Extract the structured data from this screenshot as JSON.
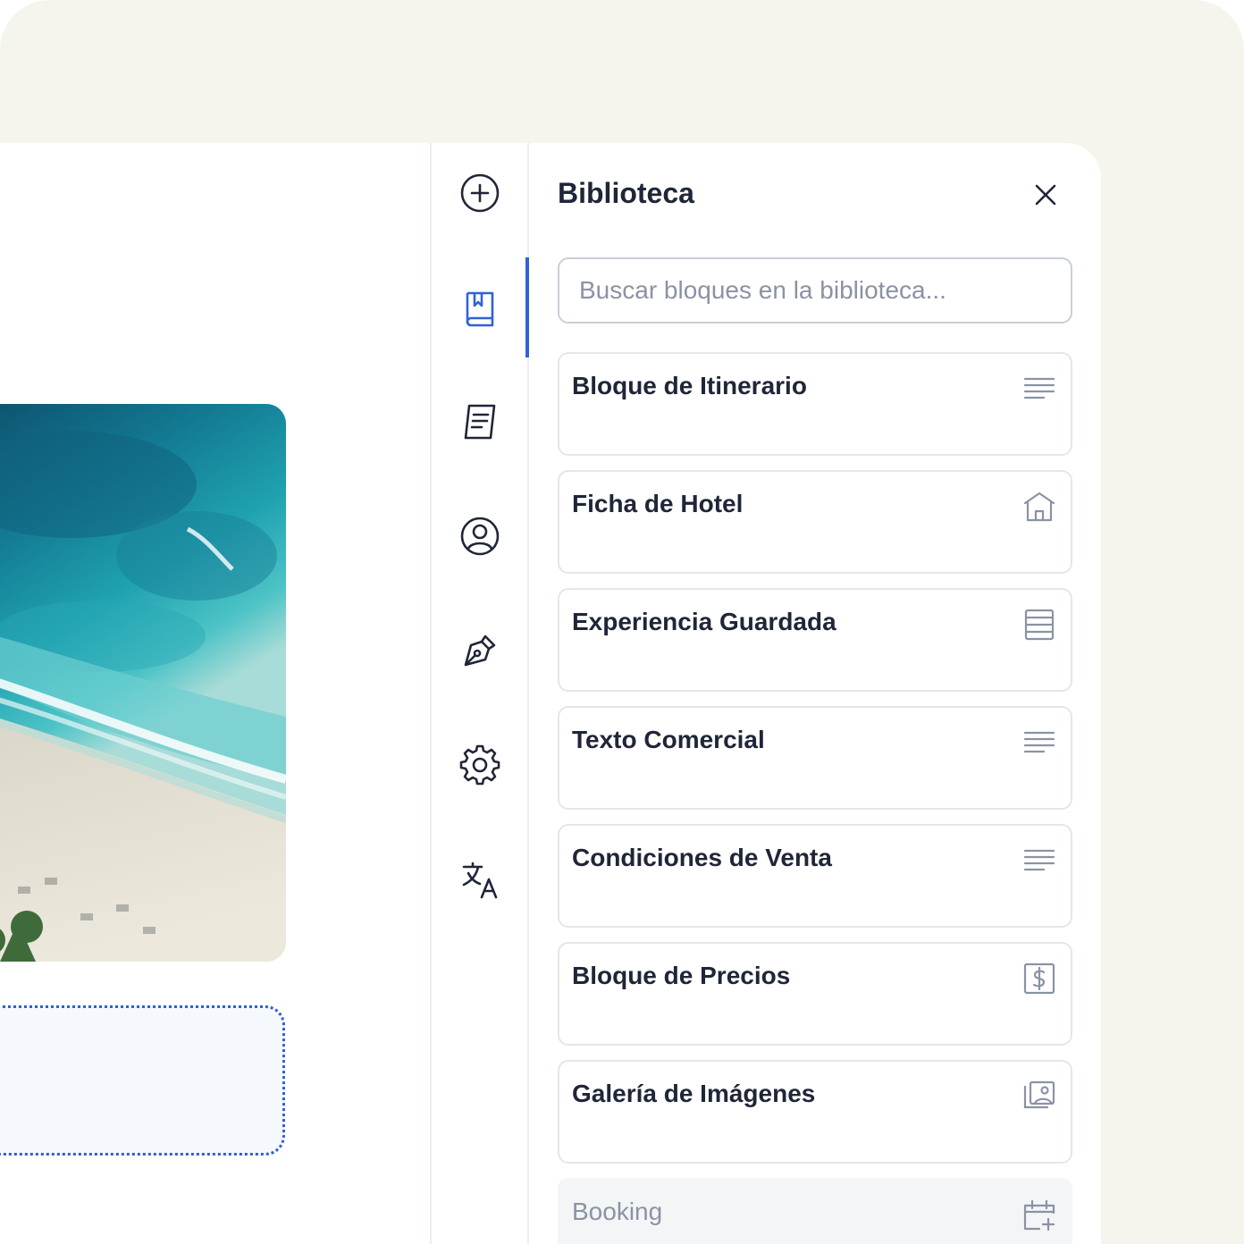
{
  "panel": {
    "title": "Biblioteca",
    "search_placeholder": "Buscar bloques en la biblioteca..."
  },
  "rail": {
    "items": [
      {
        "icon": "plus-circle-icon"
      },
      {
        "icon": "book-icon",
        "active": true
      },
      {
        "icon": "document-icon"
      },
      {
        "icon": "user-circle-icon"
      },
      {
        "icon": "pen-nib-icon"
      },
      {
        "icon": "gear-icon"
      },
      {
        "icon": "translate-icon"
      }
    ]
  },
  "blocks": [
    {
      "label": "Bloque de Itinerario",
      "icon": "text-lines-icon"
    },
    {
      "label": "Ficha de Hotel",
      "icon": "hotel-icon"
    },
    {
      "label": "Experiencia Guardada",
      "icon": "list-table-icon"
    },
    {
      "label": "Texto Comercial",
      "icon": "text-lines-icon"
    },
    {
      "label": "Condiciones de Venta",
      "icon": "text-lines-icon"
    },
    {
      "label": "Bloque de Precios",
      "icon": "price-dollar-icon"
    },
    {
      "label": "Galería de Imágenes",
      "icon": "image-gallery-icon"
    },
    {
      "label": "Booking",
      "icon": "calendar-plus-icon",
      "disabled": true
    }
  ],
  "colors": {
    "accent": "#2f63d9",
    "text": "#1f2638",
    "muted": "#8a93a3",
    "backdrop": "#f5f5ee"
  }
}
